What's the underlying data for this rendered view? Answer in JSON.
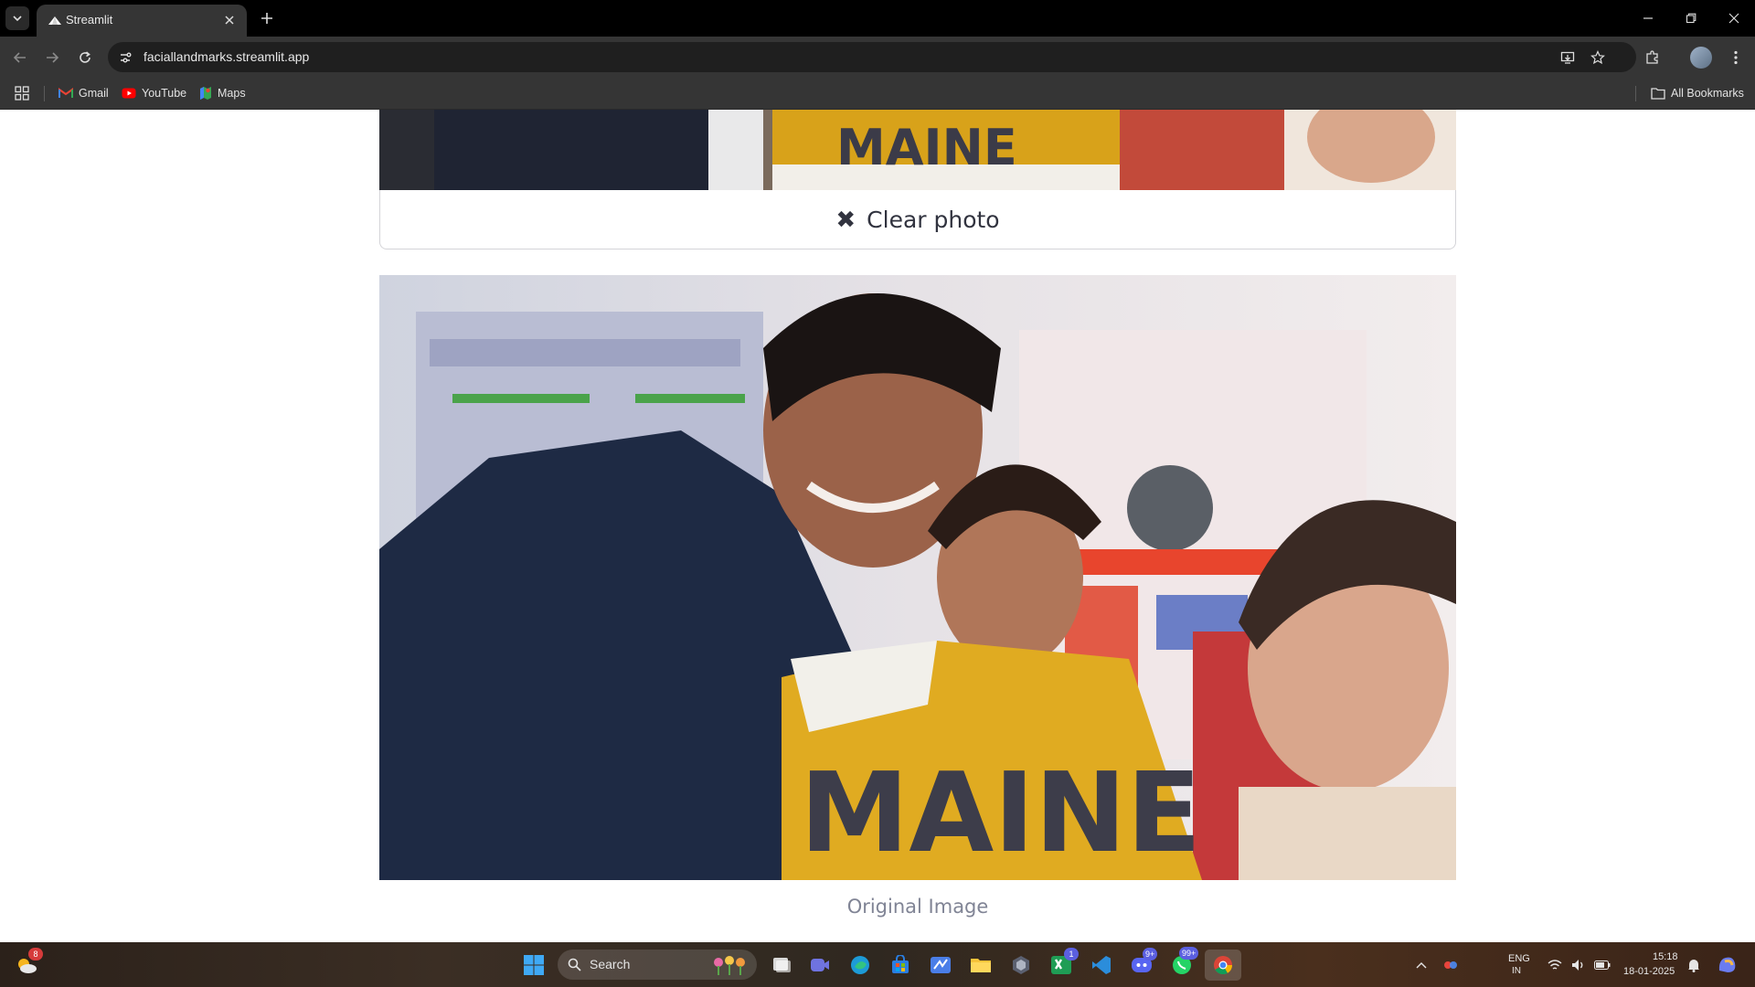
{
  "browser": {
    "tab_title": "Streamlit",
    "url": "faciallandmarks.streamlit.app",
    "bookmarks": [
      {
        "label": "Gmail",
        "icon": "gmail-icon"
      },
      {
        "label": "YouTube",
        "icon": "youtube-icon"
      },
      {
        "label": "Maps",
        "icon": "maps-icon"
      }
    ],
    "all_bookmarks_label": "All Bookmarks"
  },
  "app": {
    "clear_button_label": "Clear photo",
    "caption": "Original Image"
  },
  "taskbar": {
    "search_placeholder": "Search",
    "weather_badge": "8",
    "teams_badge": "1",
    "discord_badge": "9+",
    "whatsapp_badge": "99+",
    "language": "ENG",
    "language_sub": "IN",
    "time": "15:18",
    "date": "18-01-2025"
  },
  "colors": {
    "accent_text": "#31333f",
    "caption_text": "#808495",
    "chrome_dark": "#353535"
  }
}
